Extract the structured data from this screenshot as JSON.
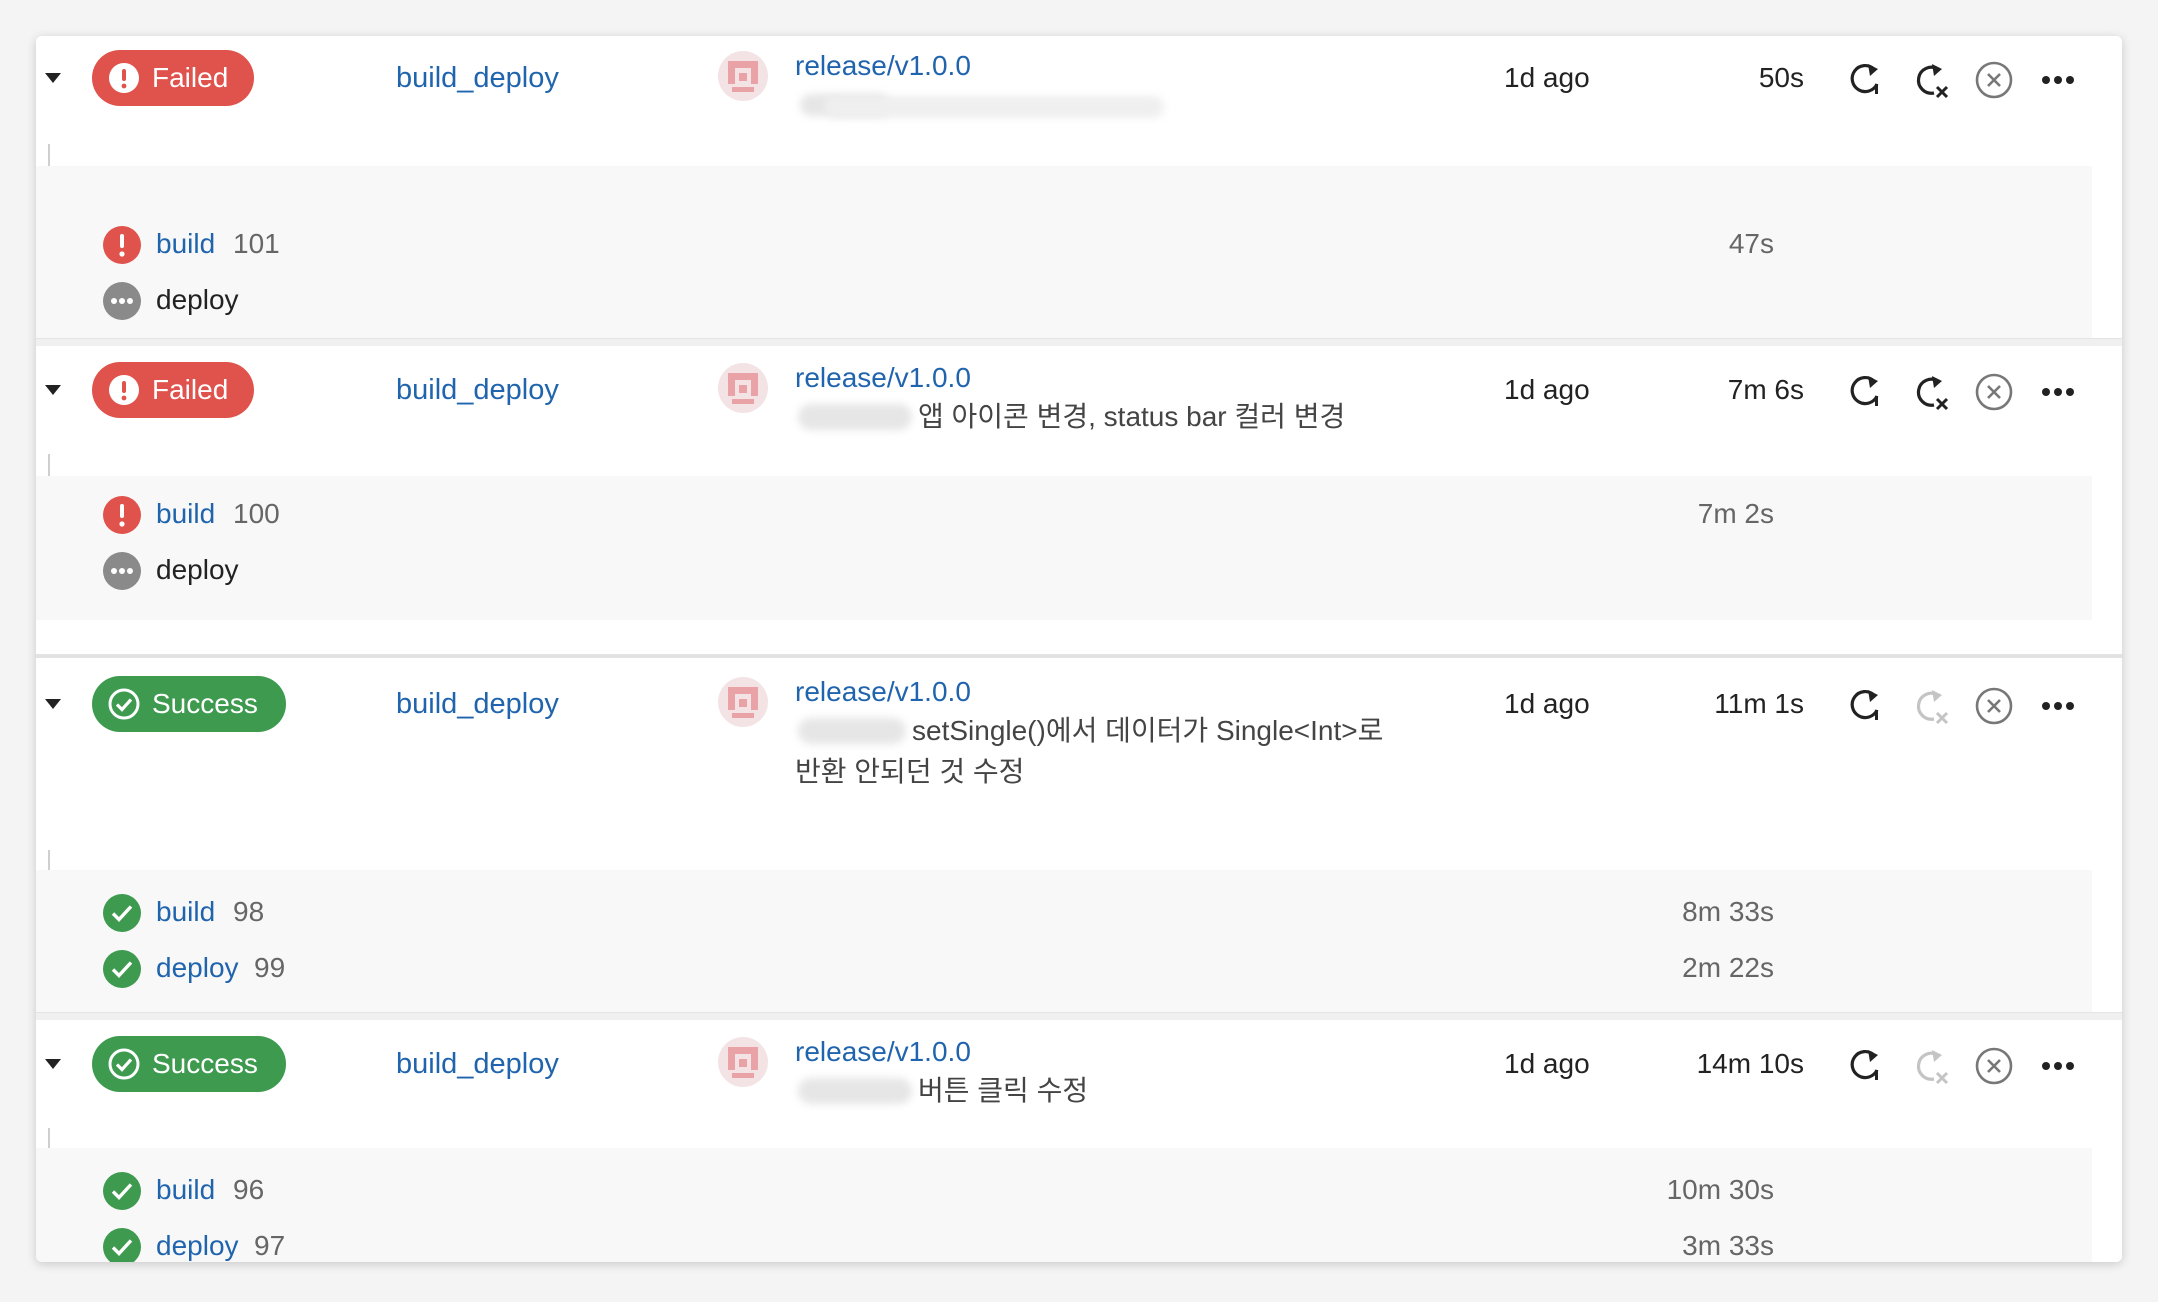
{
  "pipelines": [
    {
      "status": "Failed",
      "status_kind": "failed",
      "name": "build_deploy",
      "branch": "release/v1.0.0",
      "commit_line1": "",
      "commit_line2": "",
      "time_ago": "1d ago",
      "duration": "50s",
      "retry_failed_enabled": true,
      "jobs": [
        {
          "name": "build",
          "number": "101",
          "duration": "47s",
          "state": "failed",
          "linked": true
        },
        {
          "name": "deploy",
          "number": "",
          "duration": "",
          "state": "pending",
          "linked": false
        }
      ]
    },
    {
      "status": "Failed",
      "status_kind": "failed",
      "name": "build_deploy",
      "branch": "release/v1.0.0",
      "commit_line1": "앱 아이콘 변경, status bar 컬러 변경",
      "commit_line2": "",
      "time_ago": "1d ago",
      "duration": "7m 6s",
      "retry_failed_enabled": true,
      "jobs": [
        {
          "name": "build",
          "number": "100",
          "duration": "7m 2s",
          "state": "failed",
          "linked": true
        },
        {
          "name": "deploy",
          "number": "",
          "duration": "",
          "state": "pending",
          "linked": false
        }
      ]
    },
    {
      "status": "Success",
      "status_kind": "success",
      "name": "build_deploy",
      "branch": "release/v1.0.0",
      "commit_line1": "setSingle()에서 데이터가 Single<Int>로",
      "commit_line2": "반환 안되던 것 수정",
      "time_ago": "1d ago",
      "duration": "11m 1s",
      "retry_failed_enabled": false,
      "jobs": [
        {
          "name": "build",
          "number": "98",
          "duration": "8m 33s",
          "state": "success",
          "linked": true
        },
        {
          "name": "deploy",
          "number": "99",
          "duration": "2m 22s",
          "state": "success",
          "linked": true
        }
      ]
    },
    {
      "status": "Success",
      "status_kind": "success",
      "name": "build_deploy",
      "branch": "release/v1.0.0",
      "commit_line1": "버튼 클릭 수정",
      "commit_line2": "",
      "time_ago": "1d ago",
      "duration": "14m 10s",
      "retry_failed_enabled": false,
      "jobs": [
        {
          "name": "build",
          "number": "96",
          "duration": "10m 30s",
          "state": "success",
          "linked": true
        },
        {
          "name": "deploy",
          "number": "97",
          "duration": "3m 33s",
          "state": "success",
          "linked": true
        }
      ]
    }
  ],
  "icons": {
    "expand": "caret-down-icon",
    "failed": "exclamation-circle-icon",
    "success": "check-circle-icon",
    "pending": "ellipsis-circle-icon",
    "rerun": "rerun-icon",
    "rerun_failed": "rerun-failed-icon",
    "abort": "abort-icon",
    "more": "more-icon"
  },
  "colors": {
    "failed": "#e0524c",
    "success": "#3d9a4f",
    "pending": "#8a8a8a",
    "link": "#1f64ad"
  }
}
